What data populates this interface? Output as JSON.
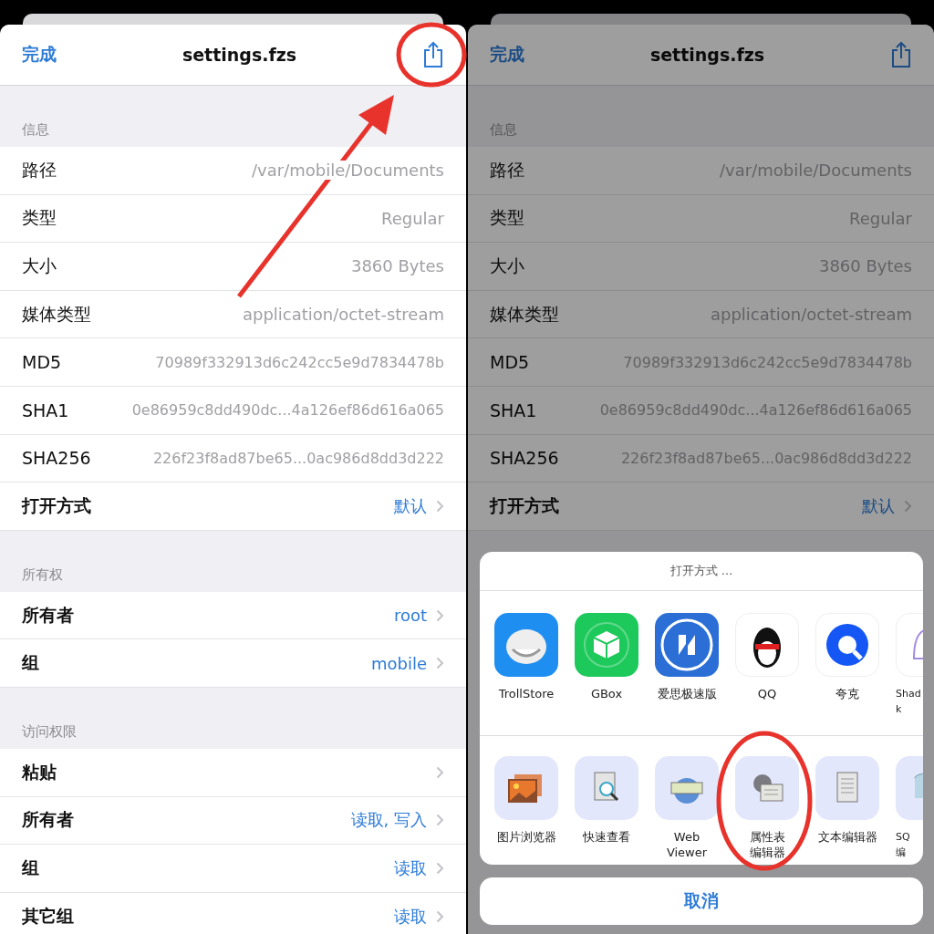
{
  "panels": [
    {
      "dimmed": false,
      "nav": {
        "done": "完成",
        "title": "settings.fzs"
      },
      "sections": [
        {
          "header": "信息",
          "rows": [
            {
              "kind": "info",
              "label": "路径",
              "value": "/var/mobile/Documents"
            },
            {
              "kind": "info",
              "label": "类型",
              "value": "Regular"
            },
            {
              "kind": "info",
              "label": "大小",
              "value": "3860 Bytes"
            },
            {
              "kind": "info",
              "label": "媒体类型",
              "value": "application/octet-stream"
            },
            {
              "kind": "info",
              "label": "MD5",
              "value": "70989f332913d6c242cc5e9d7834478b"
            },
            {
              "kind": "info",
              "label": "SHA1",
              "value": "0e86959c8dd490dc...4a126ef86d616a065"
            },
            {
              "kind": "info",
              "label": "SHA256",
              "value": "226f23f8ad87be65...0ac986d8dd3d222"
            },
            {
              "kind": "link",
              "label": "打开方式",
              "value": "默认"
            }
          ]
        },
        {
          "header": "所有权",
          "rows": [
            {
              "kind": "link",
              "label": "所有者",
              "value": "root"
            },
            {
              "kind": "link",
              "label": "组",
              "value": "mobile"
            }
          ]
        },
        {
          "header": "访问权限",
          "rows": [
            {
              "kind": "link",
              "label": "粘贴"
            },
            {
              "kind": "link",
              "label": "所有者",
              "value": "读取, 写入"
            },
            {
              "kind": "link",
              "label": "组",
              "value": "读取"
            },
            {
              "kind": "link",
              "label": "其它组",
              "value": "读取"
            }
          ]
        }
      ]
    },
    {
      "dimmed": true,
      "nav": {
        "done": "完成",
        "title": "settings.fzs"
      },
      "sections": [
        {
          "header": "信息",
          "rows": [
            {
              "kind": "info",
              "label": "路径",
              "value": "/var/mobile/Documents"
            },
            {
              "kind": "info",
              "label": "类型",
              "value": "Regular"
            },
            {
              "kind": "info",
              "label": "大小",
              "value": "3860 Bytes"
            },
            {
              "kind": "info",
              "label": "媒体类型",
              "value": "application/octet-stream"
            },
            {
              "kind": "info",
              "label": "MD5",
              "value": "70989f332913d6c242cc5e9d7834478b"
            },
            {
              "kind": "info",
              "label": "SHA1",
              "value": "0e86959c8dd490dc...4a126ef86d616a065"
            },
            {
              "kind": "info",
              "label": "SHA256",
              "value": "226f23f8ad87be65...0ac986d8dd3d222"
            },
            {
              "kind": "link",
              "label": "打开方式",
              "value": "默认"
            }
          ]
        }
      ]
    }
  ],
  "share_sheet": {
    "title": "打开方式 ...",
    "apps": [
      {
        "kind": "troll",
        "lines": [
          "TrollStore"
        ]
      },
      {
        "kind": "box",
        "lines": [
          "GBox"
        ]
      },
      {
        "kind": "bolt",
        "lines": [
          "爱思极速版"
        ]
      },
      {
        "kind": "penguin",
        "lines": [
          "QQ"
        ]
      },
      {
        "kind": "ring",
        "lines": [
          "夸克"
        ]
      },
      {
        "kind": "bell",
        "lines": [
          "Shad",
          "k"
        ]
      }
    ],
    "actions": [
      {
        "kind": "photos",
        "lines": [
          "图片浏览器"
        ]
      },
      {
        "kind": "lens",
        "lines": [
          "快速查看"
        ]
      },
      {
        "kind": "www",
        "lines": [
          "Web",
          "Viewer"
        ]
      },
      {
        "kind": "gear",
        "lines": [
          "属性表",
          "编辑器"
        ]
      },
      {
        "kind": "doc",
        "lines": [
          "文本编辑器"
        ]
      },
      {
        "kind": "db",
        "lines": [
          "SQ",
          "编"
        ]
      }
    ],
    "cancel": "取消"
  }
}
